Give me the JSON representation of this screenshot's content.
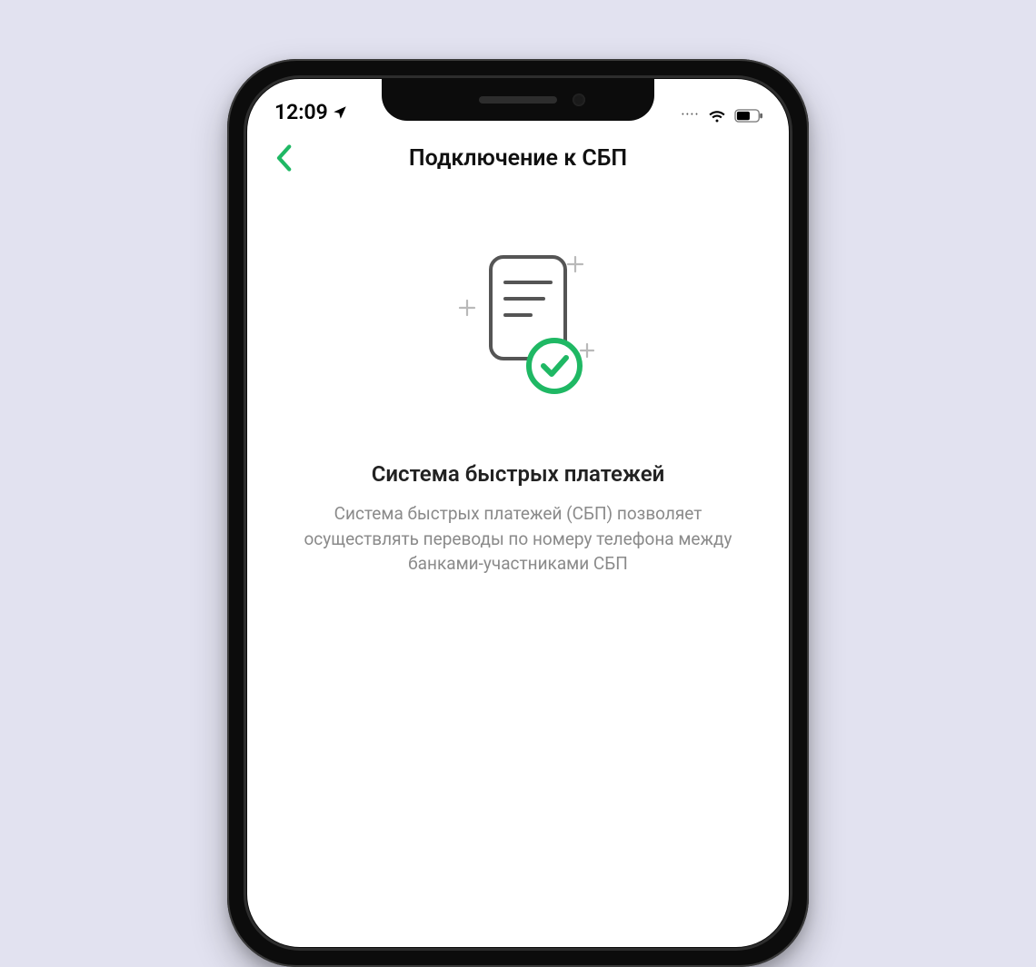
{
  "status_bar": {
    "time": "12:09",
    "location_icon": "location-arrow-icon",
    "cellular": "••••",
    "wifi_icon": "wifi-icon",
    "battery_icon": "battery-icon"
  },
  "nav": {
    "back_icon": "chevron-left-icon",
    "title": "Подключение к СБП"
  },
  "content": {
    "illustration_icon": "document-check-icon",
    "headline": "Система быстрых платежей",
    "description": "Система быстрых платежей (СБП) позволяет осуществлять переводы по номеру телефона между банками-участниками СБП"
  },
  "colors": {
    "accent": "#1fb864",
    "text_primary": "#111111",
    "text_secondary": "#8a8a8a"
  }
}
